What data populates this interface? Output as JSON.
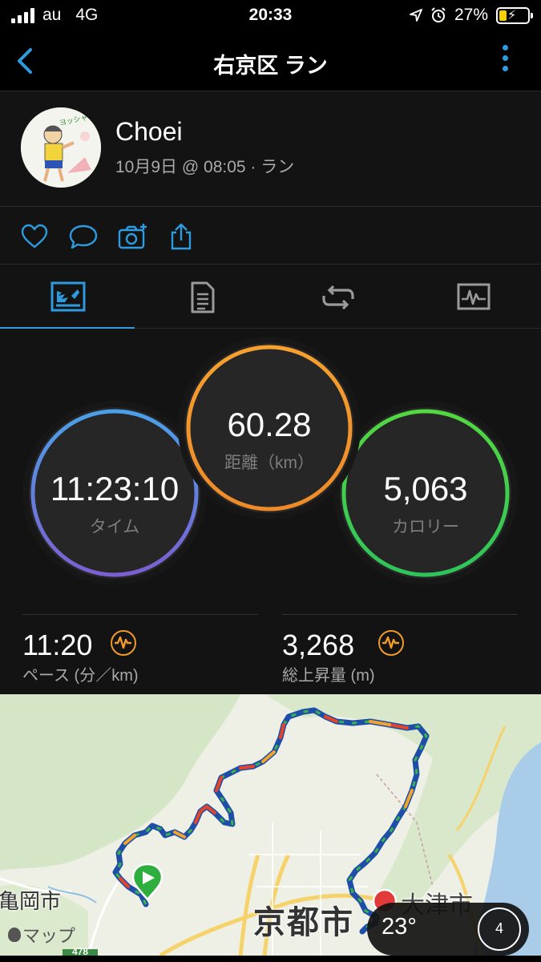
{
  "status_bar": {
    "carrier": "au",
    "network": "4G",
    "time": "20:33",
    "battery_percent": "27%",
    "battery_level": 0.27
  },
  "nav": {
    "title": "右京区 ラン"
  },
  "profile": {
    "name": "Choei",
    "meta": "10月9日 @ 08:05 · ラン",
    "avatar_caption": "ヨッシャー!"
  },
  "actions": [
    "like-icon",
    "comment-icon",
    "add-photo-icon",
    "share-icon"
  ],
  "tabs": [
    {
      "name": "overview-tab-icon",
      "active": true
    },
    {
      "name": "stats-tab-icon",
      "active": false
    },
    {
      "name": "laps-tab-icon",
      "active": false
    },
    {
      "name": "charts-tab-icon",
      "active": false
    }
  ],
  "stats": {
    "time": {
      "value": "11:23:10",
      "label": "タイム"
    },
    "distance": {
      "value": "60.28",
      "label": "距離（km）"
    },
    "calories": {
      "value": "5,063",
      "label": "カロリー"
    },
    "pace": {
      "value": "11:20",
      "label": "ペース (分／km)"
    },
    "ascent": {
      "value": "3,268",
      "label": "総上昇量 (m)"
    }
  },
  "map": {
    "city_kameoka": "亀岡市",
    "city_kyoto": "京都市",
    "city_otsu": "大津市",
    "maps_attribution": "マップ",
    "route_shield": "478",
    "weather_temp": "23°",
    "weather_dial": "4"
  },
  "colors": {
    "accent": "#2c9be0",
    "time_ring": "#5b8ed8",
    "distance_ring": "#f3952d",
    "calorie_ring": "#46d640",
    "heart_rate_badge": "#f19a26"
  }
}
